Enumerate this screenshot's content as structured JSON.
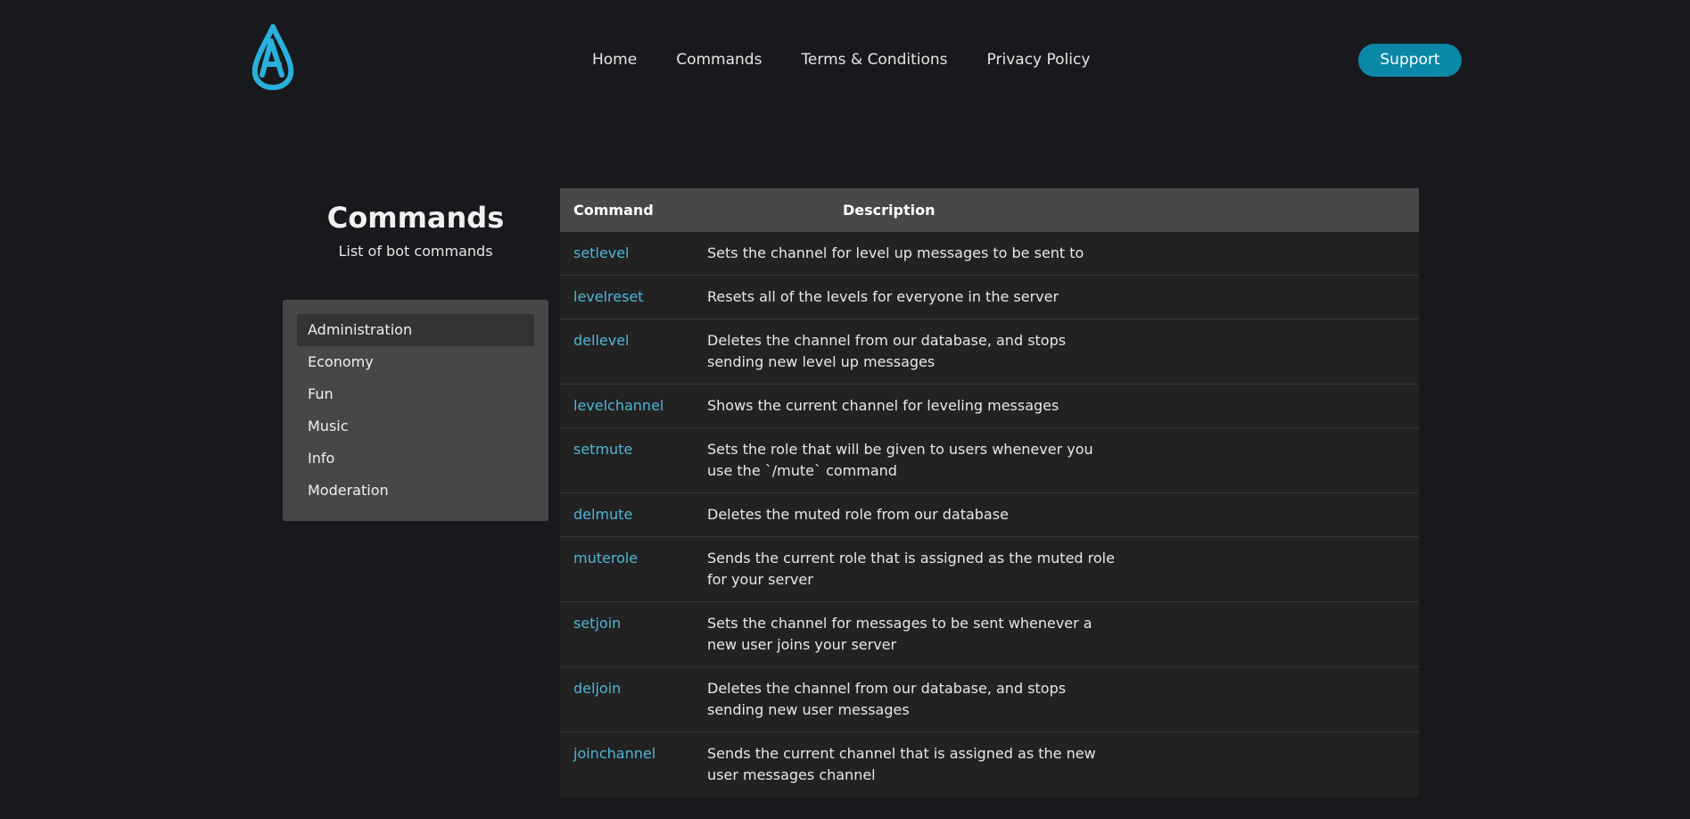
{
  "header": {
    "logo_icon": "droplet-a-logo-icon",
    "nav": [
      "Home",
      "Commands",
      "Terms & Conditions",
      "Privacy Policy"
    ],
    "support_label": "Support"
  },
  "sidebar": {
    "title": "Commands",
    "subtitle": "List of bot commands",
    "categories": [
      "Administration",
      "Economy",
      "Fun",
      "Music",
      "Info",
      "Moderation"
    ],
    "active_category": "Administration"
  },
  "table": {
    "columns": [
      "Command",
      "Description"
    ],
    "rows": [
      {
        "command": "setlevel",
        "description": "Sets the channel for level up messages to be sent to"
      },
      {
        "command": "levelreset",
        "description": "Resets all of the levels for everyone in the server"
      },
      {
        "command": "dellevel",
        "description": "Deletes the channel from our database, and stops sending new level up messages"
      },
      {
        "command": "levelchannel",
        "description": "Shows the current channel for leveling messages"
      },
      {
        "command": "setmute",
        "description": "Sets the role that will be given to users whenever you use the `/mute` command"
      },
      {
        "command": "delmute",
        "description": "Deletes the muted role from our database"
      },
      {
        "command": "muterole",
        "description": "Sends the current role that is assigned as the muted role for your server"
      },
      {
        "command": "setjoin",
        "description": "Sets the channel for messages to be sent whenever a new user joins your server"
      },
      {
        "command": "deljoin",
        "description": "Deletes the channel from our database, and stops sending new user messages"
      },
      {
        "command": "joinchannel",
        "description": "Sends the current channel that is assigned as the new user messages channel"
      }
    ]
  },
  "colors": {
    "background": "#18191d",
    "accent": "#0b87a8",
    "command_text": "#4fb5d6",
    "logo": "#2ab0dc"
  }
}
